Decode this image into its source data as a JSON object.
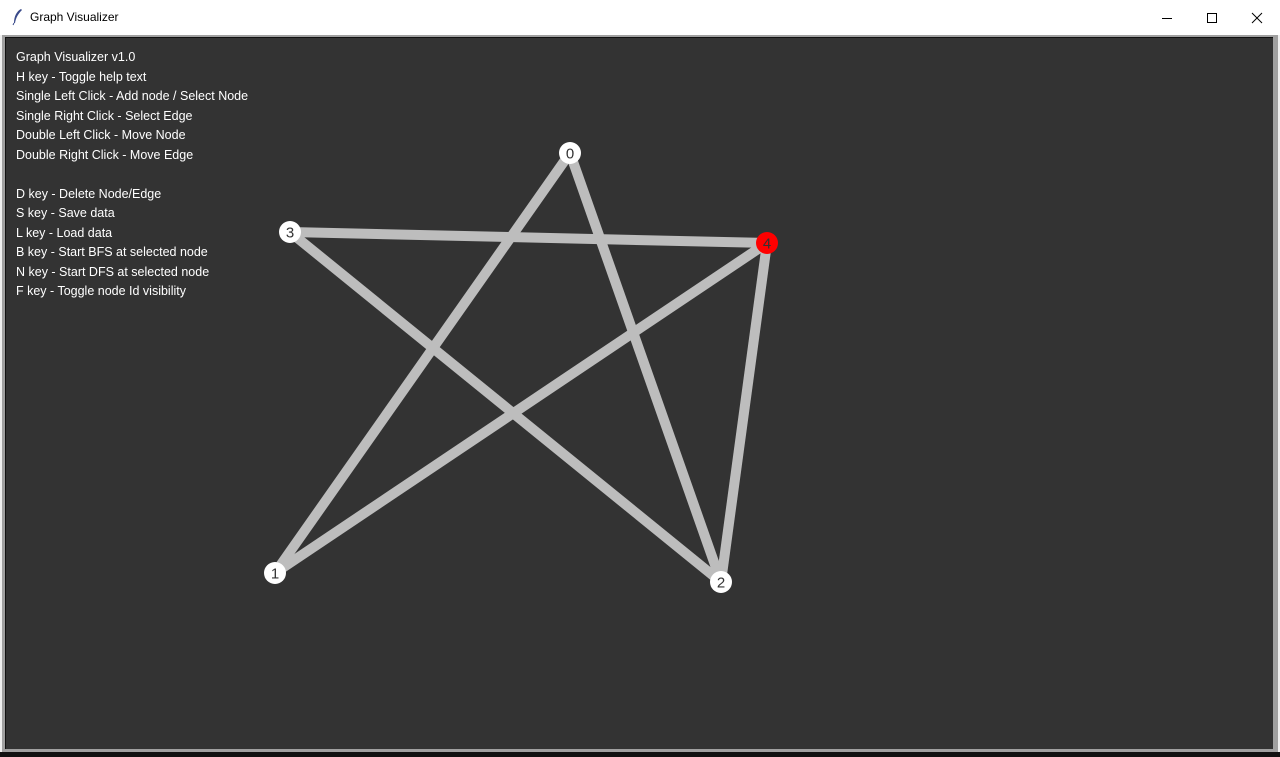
{
  "window": {
    "title": "Graph Visualizer",
    "controls": {
      "minimize": "minimize",
      "maximize": "maximize",
      "close": "close"
    }
  },
  "help": {
    "lines": [
      "Graph Visualizer v1.0",
      "H key - Toggle help text",
      "Single Left Click - Add node / Select Node",
      "Single Right Click - Select Edge",
      "Double Left Click - Move Node",
      "Double Right Click - Move Edge",
      "",
      "D key - Delete Node/Edge",
      "S key - Save data",
      "L key - Load data",
      "B key - Start BFS at selected node",
      "N key - Start DFS at selected node",
      "F key - Toggle node Id visibility"
    ]
  },
  "colors": {
    "canvas_bg": "#333333",
    "edge": "#bdbdbd",
    "node": "#ffffff",
    "selected_node": "#ff0000",
    "node_label": "#333333",
    "help_text": "#ffffff"
  },
  "graph": {
    "selected_node": "4",
    "nodes": [
      {
        "id": "0",
        "label": "0"
      },
      {
        "id": "1",
        "label": "1"
      },
      {
        "id": "2",
        "label": "2"
      },
      {
        "id": "3",
        "label": "3"
      },
      {
        "id": "4",
        "label": "4"
      }
    ],
    "edges": [
      {
        "from": "0",
        "to": "1"
      },
      {
        "from": "0",
        "to": "2"
      },
      {
        "from": "3",
        "to": "4"
      },
      {
        "from": "3",
        "to": "2"
      },
      {
        "from": "4",
        "to": "1"
      },
      {
        "from": "4",
        "to": "2"
      }
    ]
  }
}
